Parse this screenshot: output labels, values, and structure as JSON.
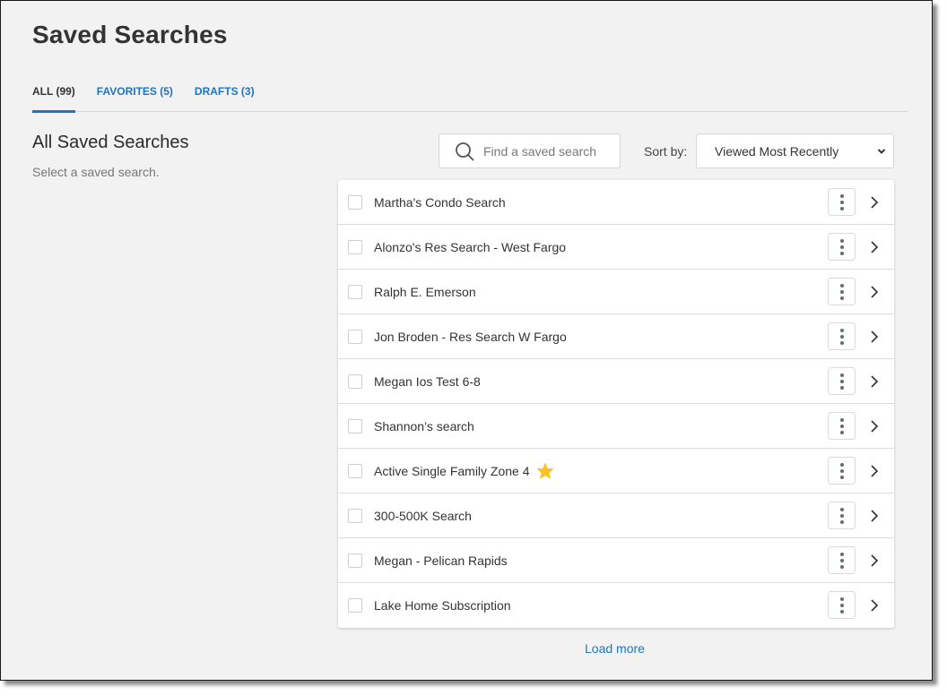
{
  "page": {
    "title": "Saved Searches"
  },
  "tabs": [
    {
      "label": "ALL (99)",
      "active": true
    },
    {
      "label": "FAVORITES (5)",
      "active": false
    },
    {
      "label": "DRAFTS (3)",
      "active": false
    }
  ],
  "section": {
    "title": "All Saved Searches",
    "subtitle": "Select a saved search."
  },
  "search": {
    "placeholder": "Find a saved search",
    "value": "",
    "icon": "search-icon"
  },
  "sort": {
    "label": "Sort by:",
    "selected": "Viewed Most Recently",
    "icon": "chevron-down-icon"
  },
  "saved_searches": [
    {
      "name": "Martha's Condo Search",
      "favorite": false,
      "checked": false
    },
    {
      "name": "Alonzo's Res Search - West Fargo",
      "favorite": false,
      "checked": false
    },
    {
      "name": "Ralph E. Emerson",
      "favorite": false,
      "checked": false
    },
    {
      "name": "Jon Broden - Res Search W Fargo",
      "favorite": false,
      "checked": false
    },
    {
      "name": "Megan Ios Test 6-8",
      "favorite": false,
      "checked": false
    },
    {
      "name": "Shannon’s search",
      "favorite": false,
      "checked": false
    },
    {
      "name": "Active Single Family Zone 4",
      "favorite": true,
      "checked": false
    },
    {
      "name": "300-500K Search",
      "favorite": false,
      "checked": false
    },
    {
      "name": "Megan - Pelican Rapids",
      "favorite": false,
      "checked": false
    },
    {
      "name": "Lake Home Subscription",
      "favorite": false,
      "checked": false
    }
  ],
  "load_more_label": "Load more",
  "colors": {
    "accent": "#1a73cc",
    "link": "#1e74c6",
    "star": "#f7c325",
    "background": "#f2f2f2"
  }
}
